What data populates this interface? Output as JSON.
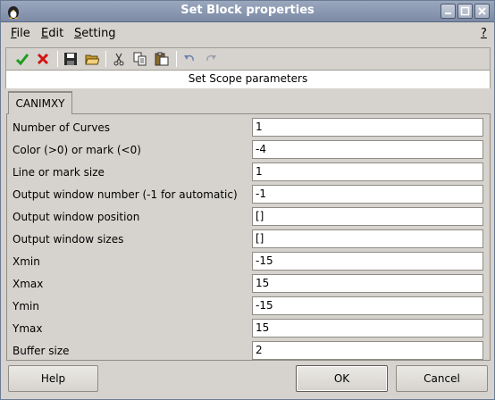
{
  "window": {
    "title": "Set Block properties"
  },
  "menu": {
    "file": "F",
    "file_rest": "ile",
    "edit": "E",
    "edit_rest": "dit",
    "setting": "S",
    "setting_rest": "etting",
    "help": "?"
  },
  "toolbar": {
    "icons": [
      "check-icon",
      "cross-icon",
      "save-icon",
      "open-folder-icon",
      "cut-icon",
      "copy-icon",
      "paste-icon",
      "undo-icon",
      "redo-icon"
    ]
  },
  "subtitle": "Set Scope parameters",
  "tab": {
    "label": "CANIMXY"
  },
  "fields": [
    {
      "label": "Number of Curves",
      "value": "1"
    },
    {
      "label": "Color (>0) or mark (<0)",
      "value": "-4"
    },
    {
      "label": "Line or mark size",
      "value": "1"
    },
    {
      "label": "Output window number (-1 for automatic)",
      "value": "-1"
    },
    {
      "label": "Output window position",
      "value": "[]"
    },
    {
      "label": "Output window sizes",
      "value": "[]"
    },
    {
      "label": "Xmin",
      "value": "-15"
    },
    {
      "label": "Xmax",
      "value": "15"
    },
    {
      "label": "Ymin",
      "value": "-15"
    },
    {
      "label": "Ymax",
      "value": "15"
    },
    {
      "label": "Buffer size",
      "value": "2"
    }
  ],
  "buttons": {
    "help": "Help",
    "ok": "OK",
    "cancel": "Cancel"
  },
  "colors": {
    "titlebar": "#7c8aa6",
    "background": "#d6d3ce",
    "check": "#1e9c1e",
    "cross": "#d21414"
  }
}
